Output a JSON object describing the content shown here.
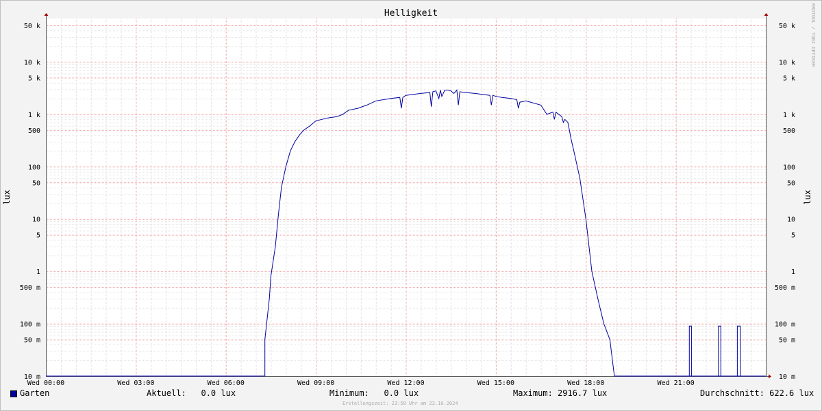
{
  "chart_data": {
    "type": "line",
    "title": "Helligkeit",
    "ylabel": "lux",
    "yscale": "log",
    "ylim": [
      0.01,
      60000
    ],
    "x_range_hours": [
      0,
      24
    ],
    "x_ticks": [
      {
        "hour": 0,
        "label": "Wed 00:00"
      },
      {
        "hour": 3,
        "label": "Wed 03:00"
      },
      {
        "hour": 6,
        "label": "Wed 06:00"
      },
      {
        "hour": 9,
        "label": "Wed 09:00"
      },
      {
        "hour": 12,
        "label": "Wed 12:00"
      },
      {
        "hour": 15,
        "label": "Wed 15:00"
      },
      {
        "hour": 18,
        "label": "Wed 18:00"
      },
      {
        "hour": 21,
        "label": "Wed 21:00"
      }
    ],
    "y_ticks": [
      {
        "value": 50000,
        "label": "50 k"
      },
      {
        "value": 10000,
        "label": "10 k"
      },
      {
        "value": 5000,
        "label": "5 k"
      },
      {
        "value": 1000,
        "label": "1 k"
      },
      {
        "value": 500,
        "label": "500"
      },
      {
        "value": 100,
        "label": "100"
      },
      {
        "value": 50,
        "label": "50"
      },
      {
        "value": 10,
        "label": "10"
      },
      {
        "value": 5,
        "label": "5"
      },
      {
        "value": 1,
        "label": "1"
      },
      {
        "value": 0.5,
        "label": "500 m"
      },
      {
        "value": 0.1,
        "label": "100 m"
      },
      {
        "value": 0.05,
        "label": "50 m"
      },
      {
        "value": 0.01,
        "label": "10 m"
      }
    ],
    "grid": true,
    "series": [
      {
        "name": "Garten",
        "color": "#0000a0",
        "x": [
          0,
          7.3,
          7.3,
          7.45,
          7.5,
          7.65,
          7.75,
          7.85,
          8.0,
          8.15,
          8.3,
          8.45,
          8.6,
          8.8,
          9.0,
          9.2,
          9.4,
          9.7,
          9.9,
          10.0,
          10.05,
          10.1,
          10.4,
          10.7,
          11.0,
          11.5,
          11.8,
          11.85,
          11.9,
          12.0,
          12.5,
          12.8,
          12.85,
          12.9,
          13.0,
          13.1,
          13.15,
          13.2,
          13.3,
          13.4,
          13.5,
          13.6,
          13.7,
          13.75,
          13.8,
          14.0,
          14.3,
          14.8,
          14.85,
          14.9,
          15.0,
          15.2,
          15.5,
          15.7,
          15.75,
          15.8,
          16.0,
          16.5,
          16.7,
          16.9,
          16.95,
          17.0,
          17.2,
          17.25,
          17.3,
          17.4,
          17.45,
          17.5,
          17.6,
          17.8,
          18.0,
          18.2,
          18.4,
          18.6,
          18.8,
          18.95,
          19.05,
          19.15,
          19.2,
          19.2,
          24.0
        ],
        "y": [
          0.01,
          0.01,
          0.05,
          0.3,
          0.8,
          3.0,
          12.0,
          40.0,
          100.0,
          200.0,
          300.0,
          400.0,
          500.0,
          600.0,
          750.0,
          800.0,
          850.0,
          900.0,
          1000.0,
          1100.0,
          1150.0,
          1200.0,
          1300.0,
          1500.0,
          1800.0,
          2000.0,
          2100.0,
          1300.0,
          2100.0,
          2300.0,
          2500.0,
          2600.0,
          1400.0,
          2700.0,
          2800.0,
          2000.0,
          2900.0,
          2200.0,
          2900.0,
          2900.0,
          2800.0,
          2500.0,
          2900.0,
          1500.0,
          2700.0,
          2600.0,
          2500.0,
          2300.0,
          1500.0,
          2300.0,
          2200.0,
          2100.0,
          2000.0,
          1900.0,
          1300.0,
          1700.0,
          1800.0,
          1500.0,
          1000.0,
          1100.0,
          800.0,
          1100.0,
          900.0,
          700.0,
          800.0,
          700.0,
          500.0,
          350.0,
          200.0,
          60.0,
          10.0,
          1.0,
          0.3,
          0.1,
          0.05,
          0.01,
          0.01,
          0.01,
          0.01,
          0.01,
          0.01
        ],
        "spikes": [
          {
            "x0": 21.45,
            "x1": 21.52,
            "y": 0.09
          },
          {
            "x0": 22.42,
            "x1": 22.5,
            "y": 0.09
          },
          {
            "x0": 23.05,
            "x1": 23.15,
            "y": 0.09
          }
        ]
      }
    ]
  },
  "footer": {
    "legend_name": "Garten",
    "current": "Aktuell:   0.0 lux",
    "minimum": "Minimum:   0.0 lux",
    "maximum": "Maximum: 2916.7 lux",
    "average": "Durchschnitt: 622.6 lux",
    "credit": "Erstellungszeit: 23:58 Uhr am 23.10.2024"
  },
  "watermark": "RRDTOOL / TOBI OETIKER"
}
